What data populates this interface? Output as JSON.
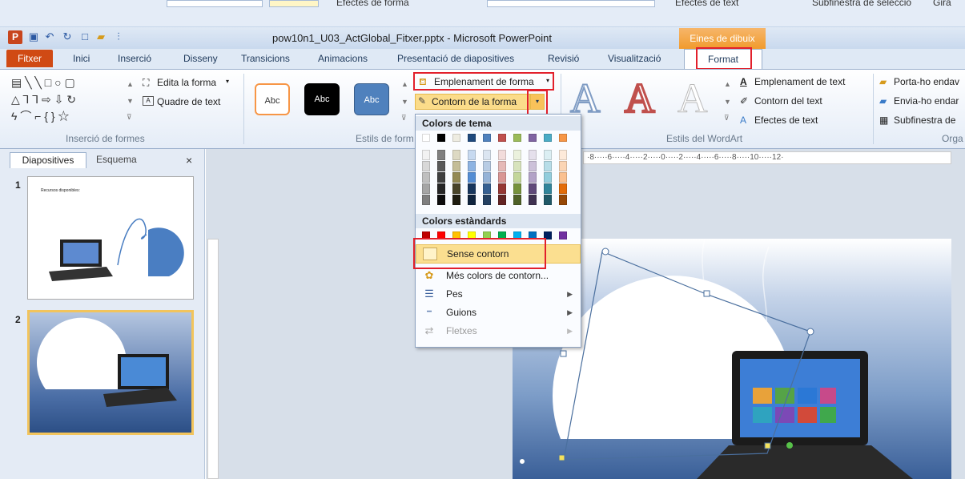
{
  "top_strip": {
    "shape_effects": "Efectes de forma",
    "text_effects": "Efectes de text",
    "selection_pane": "Subfinestra de selecció",
    "rotate": "Gira"
  },
  "titlebar": {
    "logo": "P",
    "title": "pow10n1_U03_ActGlobal_Fitxer.pptx - Microsoft PowerPoint",
    "contextual_tab": "Eines de dibuix"
  },
  "tabs": [
    "Fitxer",
    "Inici",
    "Inserció",
    "Disseny",
    "Transicions",
    "Animacions",
    "Presentació de diapositives",
    "Revisió",
    "Visualització",
    "Format"
  ],
  "ribbon": {
    "edit_shape": "Edita la forma",
    "text_box": "Quadre de text",
    "insert_shapes_label": "Inserció de formes",
    "style_abc": "Abc",
    "shape_styles_label": "Estils de form",
    "shape_fill": "Emplenament de forma",
    "shape_outline": "Contorn de la forma",
    "text_fill": "Emplenament de text",
    "text_outline": "Contorn del text",
    "text_effects": "Efectes de text",
    "wordart_label": "Estils del WordArt",
    "wordart_letter": "A",
    "bring_forward": "Porta-ho endav",
    "send_backward": "Envia-ho endar",
    "selection_pane": "Subfinestra de",
    "arrange_label": "Orga"
  },
  "menu": {
    "theme_colors": "Colors de tema",
    "standard_colors": "Colors estàndards",
    "items": [
      {
        "label": "Sense contorn",
        "icon": "no-outline-icon"
      },
      {
        "label": "Més colors de contorn...",
        "icon": "color-palette-icon"
      },
      {
        "label": "Pes",
        "icon": "weight-lines-icon"
      },
      {
        "label": "Guions",
        "icon": "dashes-icon"
      },
      {
        "label": "Fletxes",
        "icon": "arrows-icon"
      }
    ],
    "theme_top": [
      "#ffffff",
      "#000000",
      "#eeece1",
      "#1f497d",
      "#4f81bd",
      "#c0504d",
      "#9bbb59",
      "#8064a2",
      "#4bacc6",
      "#f79646"
    ],
    "theme_shades": [
      [
        "#f2f2f2",
        "#7f7f7f",
        "#ddd9c3",
        "#c6d9f0",
        "#dbe5f1",
        "#f2dcdb",
        "#ebf1dd",
        "#e5e0ec",
        "#dbeef3",
        "#fdeada"
      ],
      [
        "#d8d8d8",
        "#595959",
        "#c4bd97",
        "#8db3e2",
        "#b8cce4",
        "#e5b9b7",
        "#d7e3bc",
        "#ccc1d9",
        "#b7dde8",
        "#fbd5b5"
      ],
      [
        "#bfbfbf",
        "#3f3f3f",
        "#938953",
        "#548dd4",
        "#95b3d7",
        "#d99694",
        "#c3d69b",
        "#b2a2c7",
        "#92cddc",
        "#fac08f"
      ],
      [
        "#a5a5a5",
        "#262626",
        "#494429",
        "#17365d",
        "#366092",
        "#953734",
        "#76923c",
        "#5f497a",
        "#31859b",
        "#e36c09"
      ],
      [
        "#7f7f7f",
        "#0c0c0c",
        "#1d1b10",
        "#0f243e",
        "#244061",
        "#632423",
        "#4f6128",
        "#3f3151",
        "#205867",
        "#974806"
      ]
    ],
    "standard": [
      "#c00000",
      "#ff0000",
      "#ffc000",
      "#ffff00",
      "#92d050",
      "#00b050",
      "#00b0f0",
      "#0070c0",
      "#002060",
      "#7030a0"
    ]
  },
  "panel": {
    "tab_slides": "Diapositives",
    "tab_outline": "Esquema",
    "close": "×",
    "slide1_num": "1",
    "slide1_text": "Recursos disponibles:",
    "slide2_num": "2"
  },
  "ruler": "·8·····6·····4·····2·····0·····2·····4·····6·····8·····10·····12·"
}
